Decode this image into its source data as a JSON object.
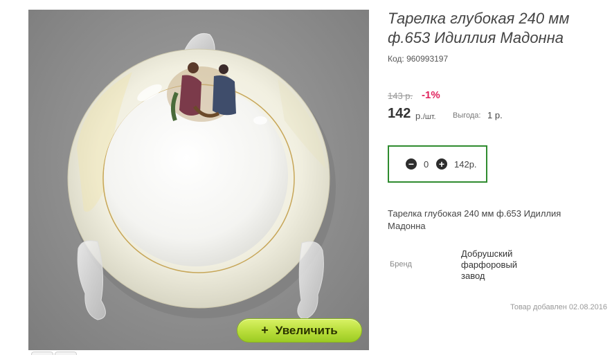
{
  "product": {
    "title": "Тарелка глубокая 240 мм ф.653 Идиллия Мадонна",
    "code": "Код: 960993197",
    "old_price": "143 р.",
    "discount": "-1%",
    "price": "142",
    "unit_prefix": "р.",
    "unit_suffix": "/шт.",
    "benefit_label": "Выгода:",
    "benefit_value": "1 р.",
    "description": "Тарелка глубокая 240 мм ф.653 Идиллия Мадонна",
    "brand_label": "Бренд",
    "brand_value": "Добрушский фарфоровый завод",
    "added": "Товар добавлен 02.08.2016"
  },
  "cart": {
    "minus_icon": "minus-circle-icon",
    "plus_icon": "plus-circle-icon",
    "quantity": "0",
    "total": "142р."
  },
  "image": {
    "zoom_label": "Увеличить",
    "zoom_icon": "plus-icon"
  },
  "colors": {
    "accent_green": "#2e8b2e",
    "discount_red": "#e0245e",
    "zoom_button": "#b8dd3a"
  }
}
